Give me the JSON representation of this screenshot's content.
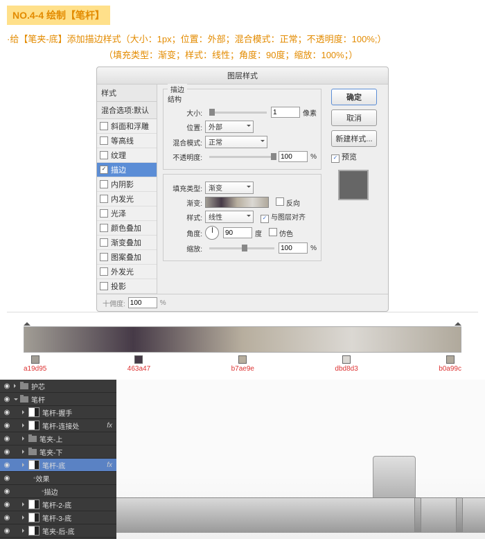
{
  "header": {
    "badge": "NO.4-4 绘制【笔杆】"
  },
  "instruction": {
    "line1": "·给【笔夹-底】添加描边样式（大小：1px；位置：外部；混合模式：正常；不透明度：100%;）",
    "line2": "（填充类型：渐变；样式：线性；角度：90度；缩放：100%；）"
  },
  "dialog": {
    "title": "图层样式",
    "left": {
      "header1": "样式",
      "header2": "混合选项:默认",
      "items": [
        {
          "label": "斜面和浮雕",
          "checked": false
        },
        {
          "label": "等高线",
          "checked": false
        },
        {
          "label": "纹理",
          "checked": false
        },
        {
          "label": "描边",
          "checked": true,
          "active": true
        },
        {
          "label": "内阴影",
          "checked": false
        },
        {
          "label": "内发光",
          "checked": false
        },
        {
          "label": "光泽",
          "checked": false
        },
        {
          "label": "颜色叠加",
          "checked": false
        },
        {
          "label": "渐变叠加",
          "checked": false
        },
        {
          "label": "图案叠加",
          "checked": false
        },
        {
          "label": "外发光",
          "checked": false
        },
        {
          "label": "投影",
          "checked": false
        }
      ]
    },
    "stroke": {
      "group1": "描边",
      "group1b": "结构",
      "sizeLabel": "大小:",
      "sizeVal": "1",
      "sizeUnit": "像素",
      "posLabel": "位置:",
      "posVal": "外部",
      "blendLabel": "混合模式:",
      "blendVal": "正常",
      "opLabel": "不透明度:",
      "opVal": "100",
      "opUnit": "%",
      "fillLabel": "填充类型:",
      "fillVal": "渐变",
      "gradLabel": "渐变:",
      "reverse": "反向",
      "styleLabel": "样式:",
      "styleVal": "线性",
      "alignLayer": "与图层对齐",
      "angleLabel": "角度:",
      "angleVal": "90",
      "angleUnit": "度",
      "dither": "仿色",
      "scaleLabel": "缩放:",
      "scaleVal": "100",
      "scaleUnit": "%"
    },
    "truncated": {
      "label": "十佣度:",
      "val": "100",
      "unit": "%"
    },
    "buttons": {
      "ok": "确定",
      "cancel": "取消",
      "newStyle": "新建样式...",
      "preview": "预览"
    }
  },
  "gradient": {
    "stops": [
      "a19d95",
      "463a47",
      "b7ae9e",
      "dbd8d3",
      "b0a99c"
    ]
  },
  "layers": [
    {
      "type": "folder",
      "label": "护芯",
      "indent": 0,
      "open": false
    },
    {
      "type": "folder",
      "label": "笔杆",
      "indent": 0,
      "open": true
    },
    {
      "type": "layer",
      "label": "笔杆-握手",
      "indent": 1
    },
    {
      "type": "layer",
      "label": "笔杆-连接处",
      "indent": 1,
      "fx": true
    },
    {
      "type": "folder",
      "label": "笔夹-上",
      "indent": 1,
      "open": false
    },
    {
      "type": "folder",
      "label": "笔夹-下",
      "indent": 1,
      "open": false
    },
    {
      "type": "layer",
      "label": "笔杆-底",
      "indent": 1,
      "fx": true,
      "active": true
    },
    {
      "type": "fx",
      "label": "效果",
      "indent": 2
    },
    {
      "type": "fx",
      "label": "描边",
      "indent": 3
    },
    {
      "type": "layer",
      "label": "笔杆-2-底",
      "indent": 1
    },
    {
      "type": "layer",
      "label": "笔杆-3-底",
      "indent": 1
    },
    {
      "type": "layer",
      "label": "笔夹-后-底",
      "indent": 1
    }
  ]
}
